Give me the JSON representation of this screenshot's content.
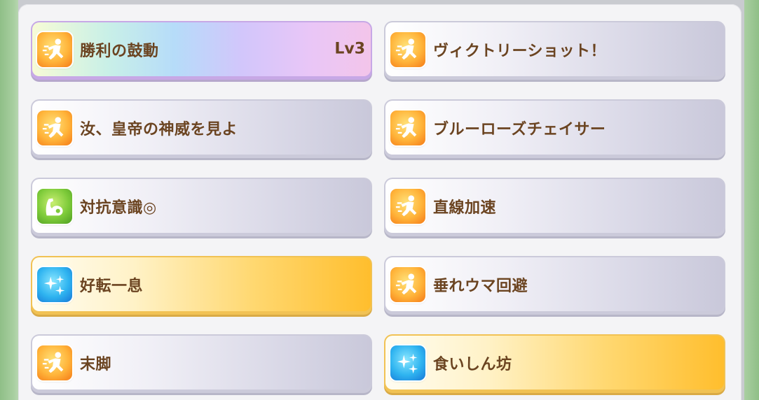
{
  "skills": [
    {
      "name": "勝利の鼓動",
      "level": "Lv3",
      "icon": "speed-runner-icon",
      "style": "rainbow"
    },
    {
      "name": "ヴィクトリーショット！",
      "icon": "speed-runner-icon",
      "style": "normal"
    },
    {
      "name": "汝、皇帝の神威を見よ",
      "icon": "speed-runner-icon",
      "style": "normal"
    },
    {
      "name": "ブルーローズチェイサー",
      "icon": "speed-runner-icon",
      "style": "normal"
    },
    {
      "name": "対抗意識◎",
      "icon": "power-arm-icon",
      "style": "normal"
    },
    {
      "name": "直線加速",
      "icon": "speed-runner-icon",
      "style": "normal"
    },
    {
      "name": "好転一息",
      "icon": "recovery-sparkle-icon",
      "style": "gold"
    },
    {
      "name": "垂れウマ回避",
      "icon": "speed-runner-icon",
      "style": "normal"
    },
    {
      "name": "末脚",
      "icon": "speed-runner-icon",
      "style": "normal"
    },
    {
      "name": "食いしん坊",
      "icon": "recovery-sparkle-icon",
      "style": "gold"
    }
  ],
  "colors": {
    "label": "#6b4421",
    "gold_end": "#ffbe2d",
    "speed_icon": "#f57a17",
    "power_icon": "#7ecb3a",
    "recover_icon": "#2fb4f0"
  }
}
